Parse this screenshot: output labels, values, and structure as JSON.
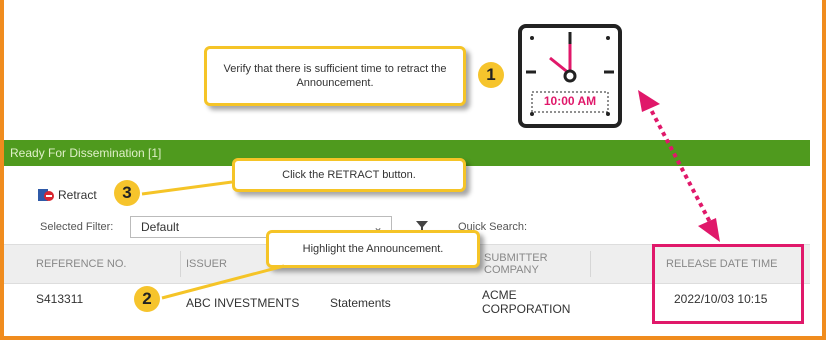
{
  "panel": {
    "header_title": "Ready For Dissemination [1]",
    "toolbar": {
      "retract_label": "Retract"
    },
    "filter": {
      "label": "Selected Filter:",
      "value": "Default",
      "quick_search_label": "Quick Search:"
    },
    "table": {
      "columns": [
        "REFERENCE NO.",
        "ISSUER",
        "SUBMITTER COMPANY",
        "RELEASE DATE TIME"
      ],
      "rows": [
        {
          "reference": "S413311",
          "issuer": "ABC INVESTMENTS",
          "type": "Statements",
          "submitter_line1": "ACME",
          "submitter_line2": "CORPORATION",
          "release": "2022/10/03 10:15"
        }
      ]
    }
  },
  "callouts": {
    "step1_text": "Verify that there is sufficient time to retract the Announcement.",
    "step1_badge": "1",
    "step2_text": "Highlight the Announcement.",
    "step2_badge": "2",
    "step3_text": "Click the RETRACT button.",
    "step3_badge": "3"
  },
  "clock": {
    "time_label": "10:00 AM"
  },
  "colors": {
    "frame": "#f08c1e",
    "header_bar": "#4f9a1e",
    "callout_border": "#f5c427",
    "badge": "#f6c42c",
    "highlight": "#e0186a",
    "clock_hands": "#e0186a"
  }
}
